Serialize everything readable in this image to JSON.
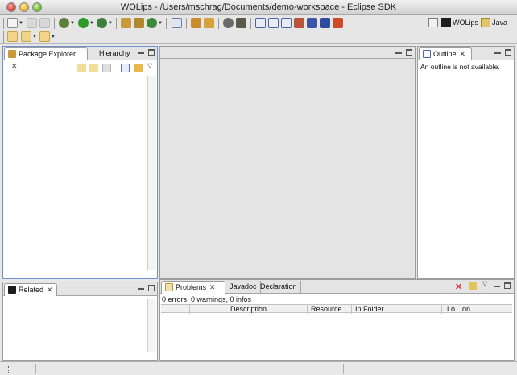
{
  "window": {
    "title": "WOLips - /Users/mschrag/Documents/demo-workspace - Eclipse SDK"
  },
  "toolbar": {
    "row1_icons": [
      "new-wizard-icon",
      "save-icon",
      "print-icon",
      "debug-icon",
      "run-icon",
      "external-tools-icon",
      "new-java-project-icon",
      "new-package-icon",
      "new-class-icon",
      "open-task-icon",
      "open-type-icon",
      "search-icon",
      "toggle-mark-occurrences-icon",
      "wo-component-icon",
      "wo-builder-icon",
      "wo-api-icon",
      "wo-eomodel-icon",
      "wo-bundle-icon",
      "wo-wizard-icon",
      "wo-deploy-icon"
    ],
    "row2_icons": [
      "last-edit-location-icon",
      "back-icon",
      "forward-icon"
    ]
  },
  "perspectives": {
    "open_perspective_icon": "open-perspective-icon",
    "items": [
      {
        "label": "WOLips",
        "icon": "wolips-perspective-icon",
        "active": true
      },
      {
        "label": "Java",
        "icon": "java-perspective-icon",
        "active": false
      }
    ]
  },
  "package_explorer": {
    "tabs": [
      {
        "label": "Package Explorer",
        "active": true,
        "icon": "package-explorer-icon"
      },
      {
        "label": "Hierarchy",
        "active": false
      }
    ],
    "toolbar_icons": [
      "back-nav-icon",
      "forward-nav-icon",
      "up-nav-icon",
      "collapse-all-icon",
      "link-with-editor-icon",
      "view-menu-icon"
    ]
  },
  "editor_area": {
    "tabs": []
  },
  "outline": {
    "tabs": [
      {
        "label": "Outline",
        "active": true,
        "icon": "outline-icon"
      }
    ],
    "message": "An outline is not available."
  },
  "related": {
    "tabs": [
      {
        "label": "Related",
        "active": true,
        "icon": "related-icon"
      }
    ]
  },
  "problems": {
    "tabs": [
      {
        "label": "Problems",
        "active": true,
        "icon": "problems-icon"
      },
      {
        "label": "Javadoc",
        "active": false
      },
      {
        "label": "Declaration",
        "active": false
      }
    ],
    "summary": "0 errors, 0 warnings, 0 infos",
    "columns": [
      "",
      "Description",
      "Resource",
      "In Folder",
      "Lo…on"
    ],
    "rows": []
  },
  "colors": {
    "accent": "#3b6fd6",
    "panel_border": "#9c9c9c",
    "tab_bar": "#e4e4e4"
  }
}
